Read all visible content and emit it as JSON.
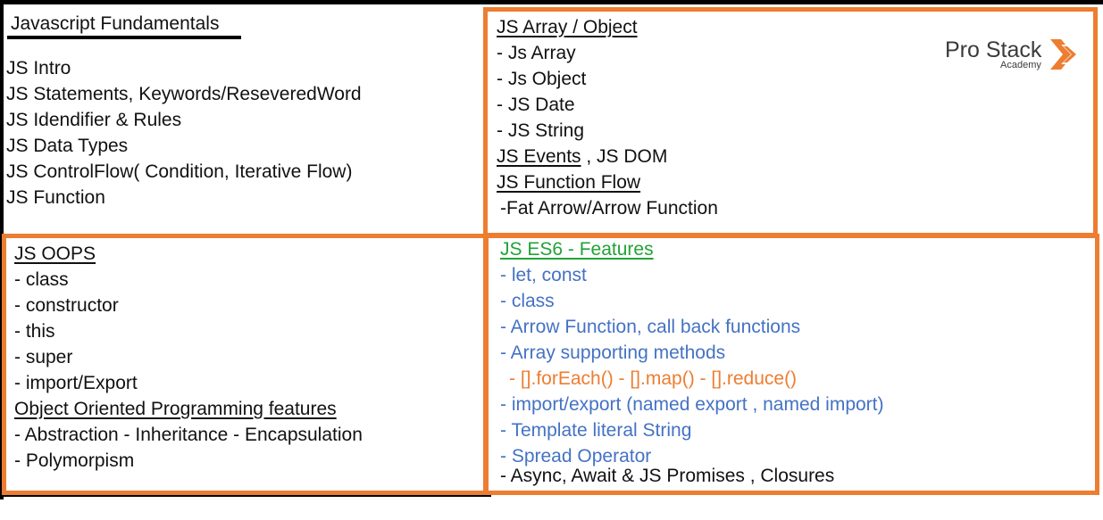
{
  "fundamentals": {
    "title": "Javascript Fundamentals",
    "items": [
      "JS Intro",
      "JS Statements, Keywords/ReseveredWord",
      "JS Idendifier & Rules",
      "JS Data Types",
      "JS ControlFlow( Condition, Iterative Flow)",
      "JS Function"
    ]
  },
  "array_object": {
    "title": "JS Array / Object",
    "items": [
      "- Js Array",
      "- Js Object",
      "- JS Date",
      "- JS String"
    ],
    "events_label": "JS Events",
    "events_suffix": " , JS DOM",
    "function_flow": "JS Function Flow",
    "fat_arrow": "-Fat Arrow/Arrow Function"
  },
  "logo": {
    "main": "Pro Stack",
    "sub": "Academy"
  },
  "oops": {
    "title": "JS OOPS",
    "items": [
      "- class",
      "- constructor",
      "- this",
      "- super",
      "- import/Export"
    ],
    "features_title": "Object Oriented Programming features",
    "features": [
      "- Abstraction  - Inheritance - Encapsulation",
      "- Polymorpism"
    ]
  },
  "es6": {
    "title": "JS ES6  - Features",
    "items": [
      "- let, const",
      "- class",
      "- Arrow Function, call back functions",
      "- Array supporting methods"
    ],
    "array_methods": "- [].forEach()  - [].map()  - [].reduce()",
    "items2": [
      "- import/export (named export , named import)",
      "- Template literal String",
      "- Spread Operator"
    ],
    "last": "- Async, Await & JS Promises , Closures"
  },
  "colors": {
    "accent_orange": "#ED7D31",
    "es6_blue": "#4472C4",
    "es6_green": "#21A336"
  }
}
